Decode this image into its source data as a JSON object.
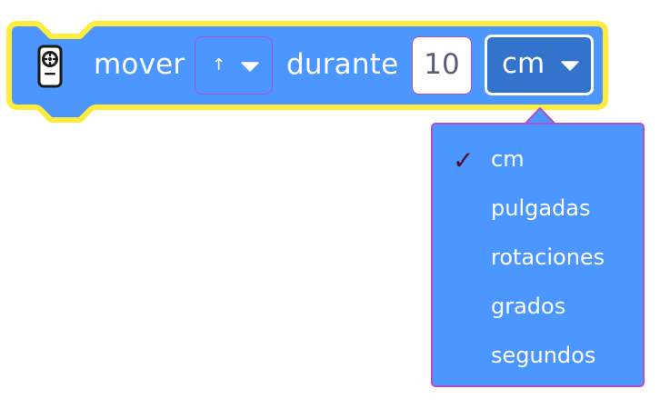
{
  "block": {
    "icon": "remote-control-icon",
    "label_move": "mover",
    "direction_value": "↑",
    "label_during": "durante",
    "amount_value": "10",
    "unit_value": "cm"
  },
  "unit_menu": {
    "selected": "cm",
    "items": [
      {
        "label": "cm",
        "checked": true
      },
      {
        "label": "pulgadas",
        "checked": false
      },
      {
        "label": "rotaciones",
        "checked": false
      },
      {
        "label": "grados",
        "checked": false
      },
      {
        "label": "segundos",
        "checked": false
      }
    ],
    "check_symbol": "✓"
  },
  "colors": {
    "block_fill": "#4c97ff",
    "block_outline": "#ffeb3b",
    "selected_field": "#3373cc",
    "field_border": "#b24dc7",
    "text": "#ffffff",
    "input_text": "#575e75",
    "check": "#4f0d2e"
  }
}
